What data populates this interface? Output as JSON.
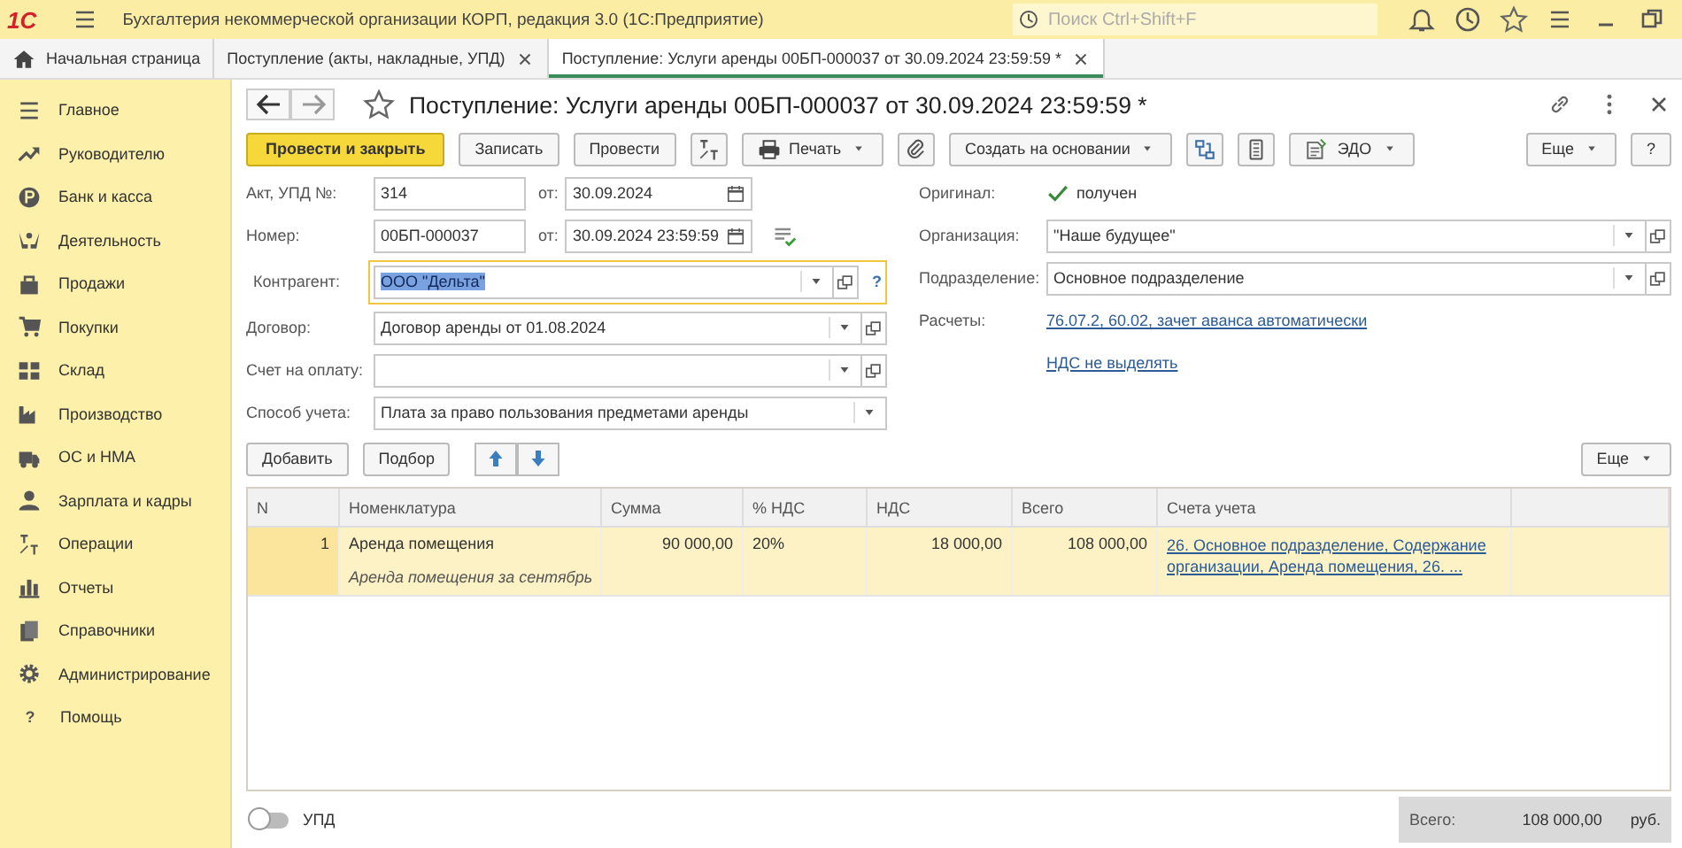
{
  "app": {
    "logo": "1С",
    "title": "Бухгалтерия некоммерческой организации КОРП, редакция 3.0  (1С:Предприятие)",
    "search_placeholder": "Поиск Ctrl+Shift+F"
  },
  "tabs": [
    {
      "label": "Начальная страница",
      "kind": "home",
      "selected": false
    },
    {
      "label": "Поступление (акты, накладные, УПД)",
      "kind": "doc",
      "selected": false
    },
    {
      "label": "Поступление: Услуги аренды 00БП-000037 от 30.09.2024 23:59:59 *",
      "kind": "doc",
      "selected": true
    }
  ],
  "sidebar": {
    "items": [
      {
        "label": "Главное",
        "kind": "menu"
      },
      {
        "label": "Руководителю",
        "kind": "trend"
      },
      {
        "label": "Банк и касса",
        "kind": "coin"
      },
      {
        "label": "Деятельность",
        "kind": "hands"
      },
      {
        "label": "Продажи",
        "kind": "bag"
      },
      {
        "label": "Покупки",
        "kind": "cart"
      },
      {
        "label": "Склад",
        "kind": "grid"
      },
      {
        "label": "Производство",
        "kind": "factory"
      },
      {
        "label": "ОС и НМА",
        "kind": "truck"
      },
      {
        "label": "Зарплата и кадры",
        "kind": "person"
      },
      {
        "label": "Операции",
        "kind": "dtkt"
      },
      {
        "label": "Отчеты",
        "kind": "bars"
      },
      {
        "label": "Справочники",
        "kind": "books"
      },
      {
        "label": "Администрирование",
        "kind": "gear"
      },
      {
        "label": "Помощь",
        "kind": "help",
        "glyph": "?"
      }
    ]
  },
  "form": {
    "title": "Поступление: Услуги аренды 00БП-000037 от 30.09.2024 23:59:59 *",
    "toolbar": {
      "left": [
        {
          "kind": "primary",
          "label": "Провести и закрыть"
        },
        {
          "kind": "button",
          "label": "Записать"
        },
        {
          "kind": "button",
          "label": "Провести"
        },
        {
          "kind": "ledger"
        },
        {
          "kind": "print",
          "label": "Печать"
        },
        {
          "kind": "attach"
        },
        {
          "kind": "menu",
          "label": "Создать на основании"
        },
        {
          "kind": "structure"
        },
        {
          "kind": "calculator"
        },
        {
          "kind": "edo",
          "label": "ЭДО"
        }
      ],
      "right": [
        {
          "kind": "menu",
          "label": "Еще"
        },
        {
          "kind": "button",
          "label": "?"
        }
      ]
    },
    "left_fields": [
      {
        "label": "Акт, УПД №:",
        "kind": "input",
        "value": "314",
        "focused": false,
        "date": {
          "label": "от:",
          "value": "30.09.2024"
        }
      },
      {
        "label": "Номер:",
        "kind": "input",
        "value": "00БП-000037",
        "focused": false,
        "date": {
          "label": "от:",
          "value": "30.09.2024 23:59:59"
        },
        "action_icon": true
      },
      {
        "label": "Контрагент:",
        "kind": "select",
        "value": "ООО \"Дельта\"",
        "focused": true,
        "help": "?"
      },
      {
        "label": "Договор:",
        "kind": "select",
        "value": "Договор аренды от 01.08.2024",
        "focused": false
      },
      {
        "label": "Счет на оплату:",
        "kind": "select",
        "focused": false
      },
      {
        "label": "Способ учета:",
        "kind": "dropdown",
        "value": "Плата за право пользования предметами аренды",
        "focused": false
      }
    ],
    "right_fields": [
      {
        "label": "Оригинал:",
        "kind": "checkbox",
        "value": "получен",
        "checked": true
      },
      {
        "label": "Организация:",
        "kind": "select",
        "value": "\"Наше будущее\""
      },
      {
        "label": "Подразделение:",
        "kind": "select",
        "value": "Основное подразделение"
      },
      {
        "label": "Расчеты:",
        "kind": "link",
        "value": "76.07.2, 60.02, зачет аванса автоматически"
      },
      {
        "kind": "link",
        "value": "НДС не выделять"
      }
    ],
    "table_toolbar": {
      "left": [
        {
          "kind": "button",
          "label": "Добавить"
        },
        {
          "kind": "button",
          "label": "Подбор"
        },
        {
          "kind": "arrows"
        }
      ],
      "right": [
        {
          "kind": "menu",
          "label": "Еще"
        }
      ]
    },
    "table": {
      "columns": [
        {
          "label": "N"
        },
        {
          "label": "Номенклатура"
        },
        {
          "label": "Сумма"
        },
        {
          "label": "% НДС"
        },
        {
          "label": "НДС"
        },
        {
          "label": "Всего"
        },
        {
          "label": "Счета учета"
        }
      ],
      "rows": [
        {
          "selected": true,
          "n": "1",
          "item": "Аренда помещения",
          "comment": "Аренда помещения за сентябрь",
          "sum": "90 000,00",
          "vat_rate": "20%",
          "vat": "18 000,00",
          "total": "108 000,00",
          "accounts": "26. Основное подразделение, Содержание организации, Аренда помещения, 26. ..."
        }
      ]
    },
    "footer": {
      "toggle": {
        "label": "УПД",
        "on": false
      },
      "total": {
        "label": "Всего:",
        "value": "108 000,00",
        "currency": "руб."
      }
    }
  }
}
